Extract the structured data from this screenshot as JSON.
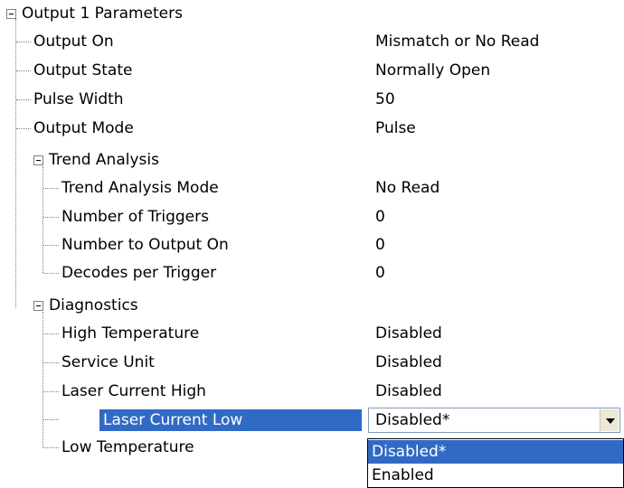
{
  "tree": {
    "root": {
      "label": "Output 1 Parameters"
    },
    "output_params": [
      {
        "label": "Output On",
        "value": "Mismatch or No Read"
      },
      {
        "label": "Output State",
        "value": "Normally Open"
      },
      {
        "label": "Pulse Width",
        "value": "50"
      },
      {
        "label": "Output Mode",
        "value": "Pulse"
      }
    ],
    "trend_analysis": {
      "label": "Trend Analysis",
      "items": [
        {
          "label": "Trend Analysis Mode",
          "value": "No Read"
        },
        {
          "label": "Number of Triggers",
          "value": "0"
        },
        {
          "label": "Number to Output On",
          "value": "0"
        },
        {
          "label": "Decodes per Trigger",
          "value": "0"
        }
      ]
    },
    "diagnostics": {
      "label": "Diagnostics",
      "items": [
        {
          "label": "High Temperature",
          "value": "Disabled"
        },
        {
          "label": "Service Unit",
          "value": "Disabled"
        },
        {
          "label": "Laser Current High",
          "value": "Disabled"
        },
        {
          "label": "Laser Current Low",
          "value": "Disabled*"
        },
        {
          "label": "Low Temperature",
          "value": ""
        }
      ]
    }
  },
  "combo": {
    "selected_value": "Disabled*",
    "options": [
      "Disabled*",
      "Enabled"
    ]
  },
  "colors": {
    "selection": "#316ac5",
    "tree_lines": "#808080"
  }
}
